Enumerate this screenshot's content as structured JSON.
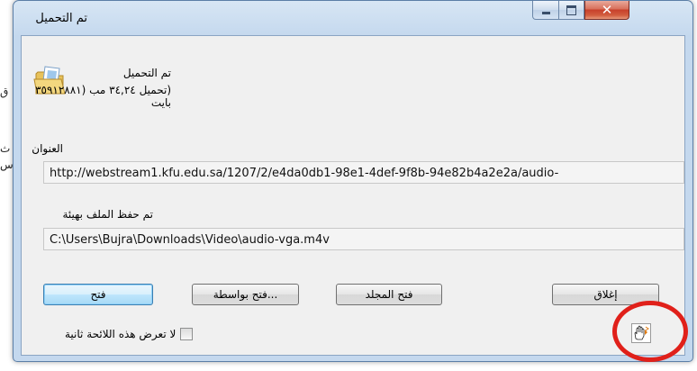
{
  "window": {
    "title": "تم التحميل"
  },
  "background": {
    "fragments": [
      "ق",
      "ث",
      "س"
    ]
  },
  "header": {
    "status": "تم التحميل",
    "size_info": "(تحميل ٣٤,٢٤ مب (٣٥٩١٢٨٨١ بايت",
    "icon": "folder-icon"
  },
  "address": {
    "label": "العنوان",
    "value": "http://webstream1.kfu.edu.sa/1207/2/e4da0db1-98e1-4def-9f8b-94e82b4a2e2a/audio-"
  },
  "saved_as": {
    "label": "تم حفظ الملف بهيئة",
    "value": "C:\\Users\\Bujra\\Downloads\\Video\\audio-vga.m4v"
  },
  "buttons": {
    "open": "فتح",
    "open_with": "...فتح بواسطة",
    "open_folder": "فتح المجلد",
    "close": "إغلاق"
  },
  "checkbox": {
    "label": "لا تعرض هذه اللائحة ثانية",
    "checked": false
  },
  "colors": {
    "annotation_circle": "#e0201a",
    "default_button_border": "#3c7fb1"
  }
}
